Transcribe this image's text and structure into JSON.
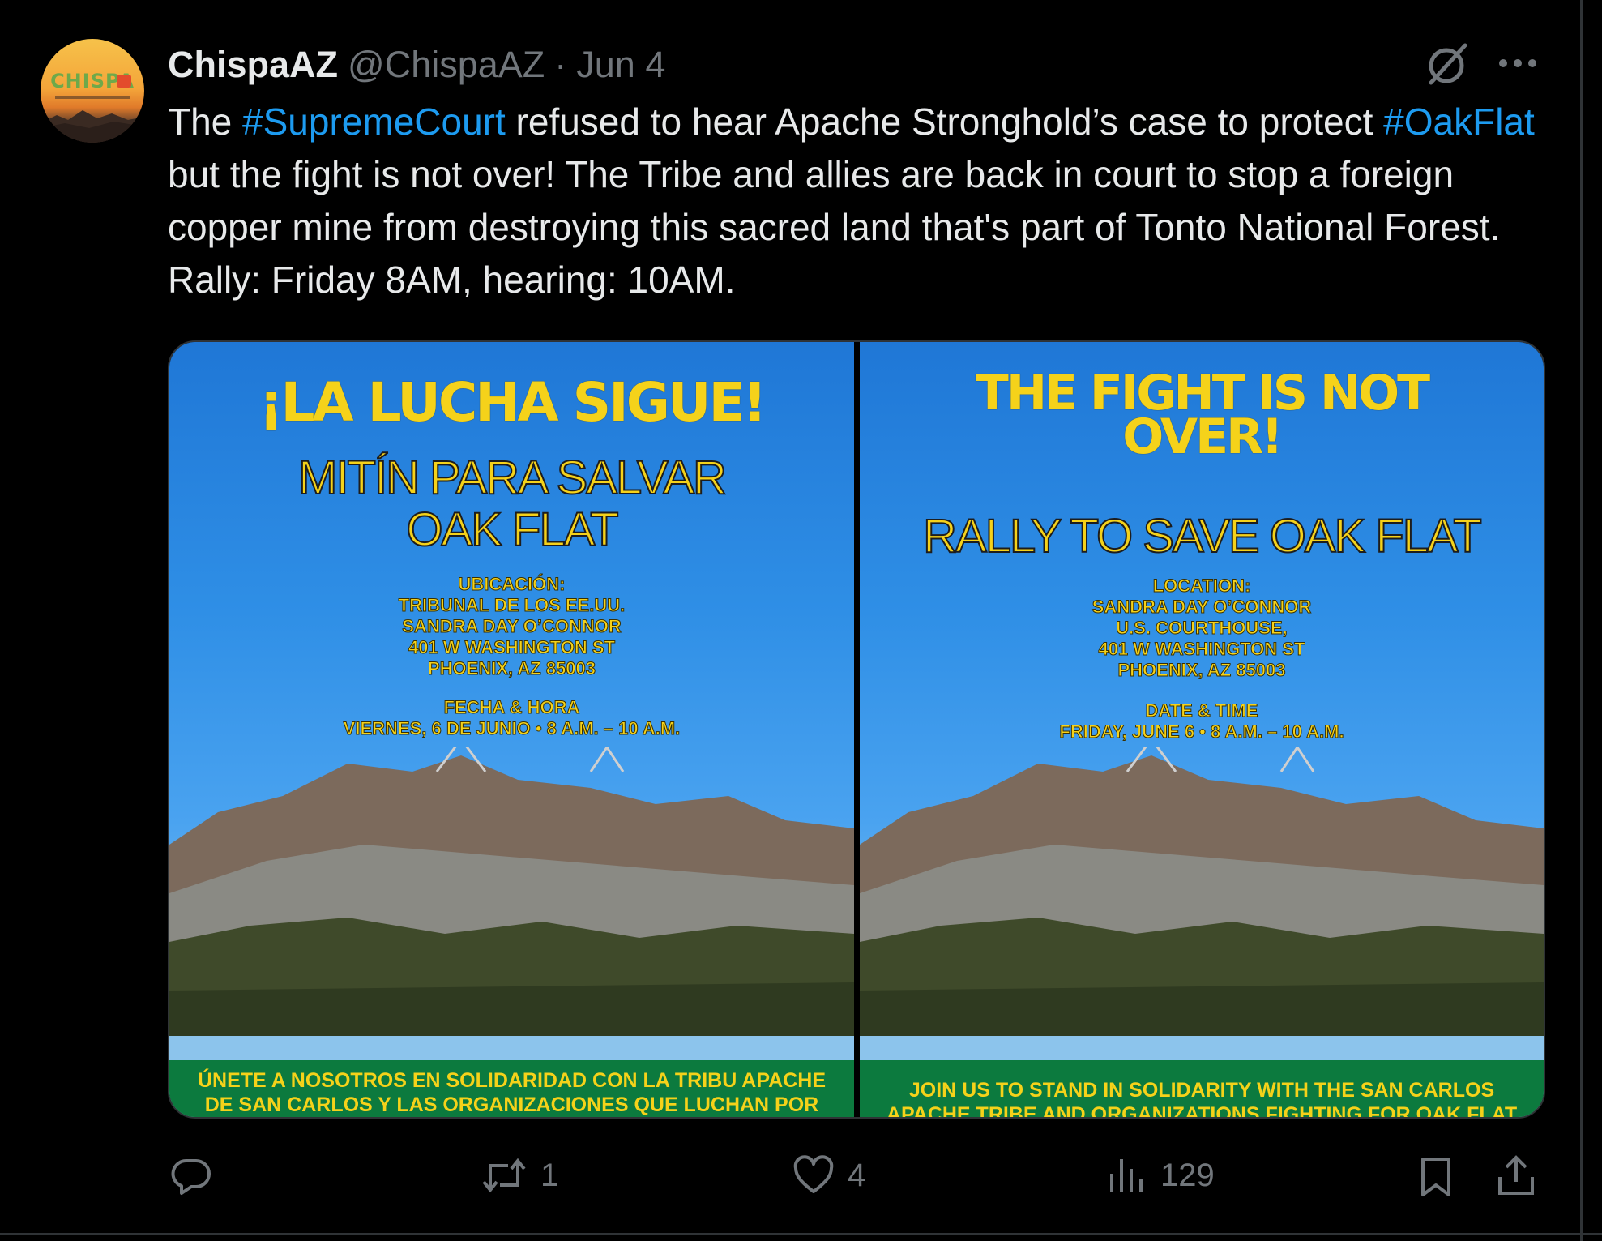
{
  "tweet": {
    "author_name": "ChispaAZ",
    "author_handle": "@ChispaAZ",
    "separator": "·",
    "date": "Jun 4",
    "avatar_text": "CHISPA",
    "text_parts": [
      {
        "type": "text",
        "value": "The "
      },
      {
        "type": "hashtag",
        "value": "#SupremeCourt"
      },
      {
        "type": "text",
        "value": " refused to hear Apache Stronghold’s case to protect "
      },
      {
        "type": "hashtag",
        "value": "#OakFlat"
      },
      {
        "type": "text",
        "value": " but the fight is not over! The Tribe and allies are back in court to stop a foreign copper mine from destroying this sacred land that's part of Tonto National Forest. Rally: Friday 8AM, hearing: 10AM."
      }
    ]
  },
  "media": {
    "left_poster": {
      "headline": "¡LA LUCHA SIGUE!",
      "subhead": "MITÍN PARA SALVAR\nOAK FLAT",
      "location": "UBICACIÓN:\nTRIBUNAL DE LOS EE.UU.\nSANDRA DAY O’CONNOR\n401 W WASHINGTON ST\nPHOENIX, AZ 85003",
      "datetime": "FECHA & HORA\nVIERNES, 6 DE JUNIO • 8 A.M. – 10 A.M.",
      "footer": "ÚNETE A NOSOTROS EN SOLIDARIDAD CON LA TRIBU APACHE\nDE SAN CARLOS Y LAS ORGANIZACIONES QUE LUCHAN POR"
    },
    "right_poster": {
      "headline": "THE FIGHT IS NOT\nOVER!",
      "subhead": "RALLY TO SAVE OAK FLAT",
      "location": "LOCATION:\nSANDRA DAY O’CONNOR\nU.S. COURTHOUSE,\n401 W WASHINGTON ST\nPHOENIX, AZ 85003",
      "datetime": "DATE & TIME\nFRIDAY, JUNE 6 • 8 A.M. – 10 A.M.",
      "footer": "JOIN US TO STAND IN SOLIDARITY WITH THE SAN CARLOS\nAPACHE TRIBE AND ORGANIZATIONS FIGHTING FOR OAK FLAT"
    }
  },
  "actions": {
    "reply_icon": "reply-icon",
    "retweet_icon": "retweet-icon",
    "retweet_count": "1",
    "like_icon": "heart-icon",
    "like_count": "4",
    "views_icon": "views-chart-icon",
    "views_count": "129",
    "bookmark_icon": "bookmark-icon",
    "share_icon": "share-icon"
  },
  "colors": {
    "background": "#000000",
    "text": "#e7e9ea",
    "muted": "#71767b",
    "hashtag": "#1d9bf0",
    "poster_yellow": "#f5d21a",
    "poster_green": "#0c7a3e",
    "sky_blue": "#2f8fe6"
  }
}
